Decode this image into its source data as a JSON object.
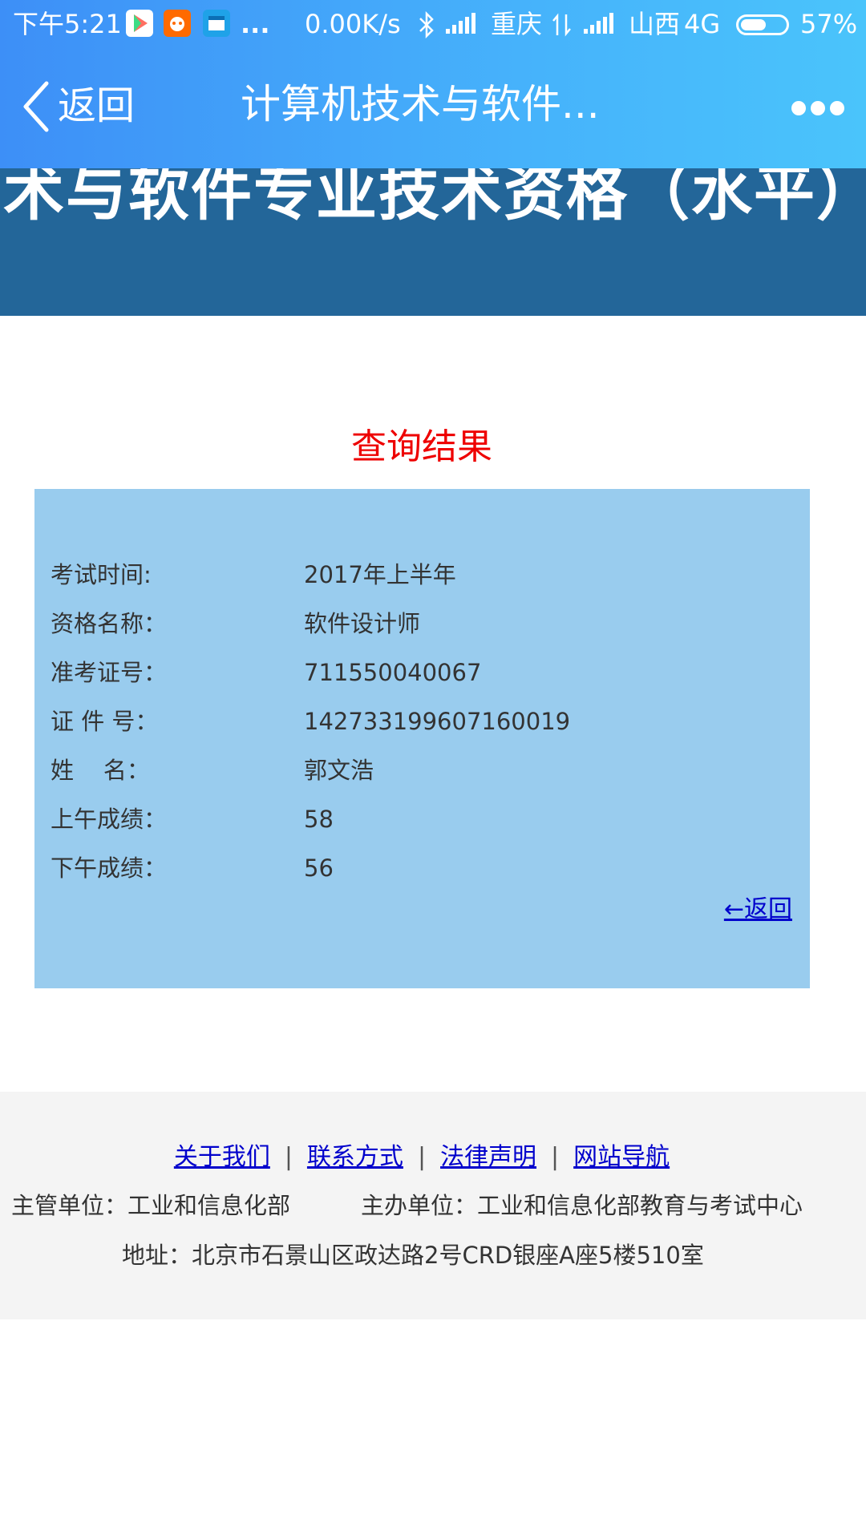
{
  "status_bar": {
    "time": "下午5:21",
    "more": "...",
    "speed": "0.00K/s",
    "carrier1": "重庆",
    "carrier2": "山西",
    "network": "4G",
    "battery": "57%",
    "battery_level": 0.57
  },
  "header": {
    "back_label": "返回",
    "title": "计算机技术与软件..."
  },
  "banner": {
    "text": "术与软件专业技术资格（水平）"
  },
  "result": {
    "title": "查询结果",
    "rows": [
      {
        "label": "考试时间:",
        "value": "2017年上半年"
      },
      {
        "label": "资格名称：",
        "value": "软件设计师"
      },
      {
        "label": "准考证号：",
        "value": "711550040067"
      },
      {
        "label": "证 件 号：",
        "value": "142733199607160019"
      },
      {
        "label": "姓    名：",
        "value": "郭文浩"
      },
      {
        "label": "上午成绩：",
        "value": "58"
      },
      {
        "label": "下午成绩：",
        "value": "56"
      }
    ],
    "back_link": "←返回"
  },
  "footer": {
    "links": [
      "关于我们",
      "联系方式",
      "法律声明",
      "网站导航"
    ],
    "separator": "|",
    "supervisor": "主管单位：工业和信息化部",
    "organizer": "主办单位：工业和信息化部教育与考试中心",
    "address": "地址：北京市石景山区政达路2号CRD银座A座5楼510室"
  },
  "colors": {
    "header_blue": "#46b2fb",
    "banner_blue": "#236699",
    "panel_blue": "#99ccee",
    "result_title_red": "#ee0000",
    "link_blue": "#0000cc",
    "footer_bg": "#f4f4f4"
  }
}
